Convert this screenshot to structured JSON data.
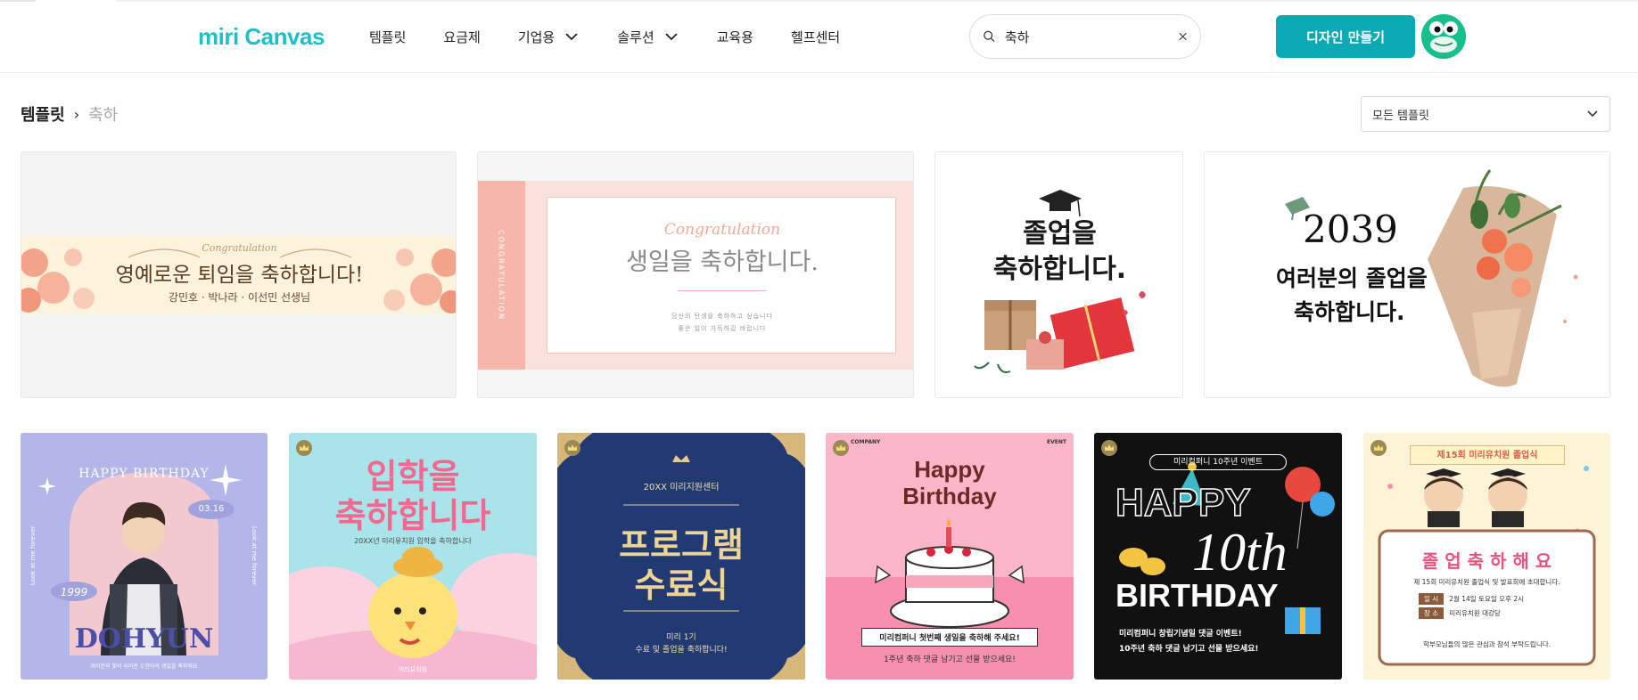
{
  "header": {
    "logo": "miri Canvas",
    "nav": [
      {
        "label": "템플릿",
        "dropdown": false
      },
      {
        "label": "요금제",
        "dropdown": false
      },
      {
        "label": "기업용",
        "dropdown": true
      },
      {
        "label": "솔루션",
        "dropdown": true
      },
      {
        "label": "교육용",
        "dropdown": false
      },
      {
        "label": "헬프센터",
        "dropdown": false
      }
    ],
    "search_value": "축하",
    "design_button": "디자인 만들기"
  },
  "breadcrumb": {
    "root": "템플릿",
    "current": "축하"
  },
  "filter": {
    "selected": "모든 템플릿"
  },
  "cards": {
    "c1": {
      "script": "Congratulation",
      "title": "영예로운 퇴임을 축하합니다!",
      "subtitle": "강민호 · 박나라 · 이선민 선생님"
    },
    "c2": {
      "side": "CONGRATULATION",
      "script": "Congratulation",
      "title": "생일을 축하합니다.",
      "line1": "당신의 탄생을 축하하고 싶습니다",
      "line2": "좋은 일이 가득하길 바랍니다"
    },
    "c3": {
      "line1": "졸업을",
      "line2": "축하합니다."
    },
    "c4": {
      "year": "2039",
      "line1": "여러분의 졸업을",
      "line2": "축하합니다."
    },
    "c5": {
      "top": "HAPPY BIRTHDAY",
      "date": "03.16",
      "year": "1999",
      "name": "DOHYUN",
      "side_left": "Look at me forever",
      "side_right": "Look at me forever",
      "footer": "여러분의 빛이 되어준 도현이의 생일을 축하해요"
    },
    "c6": {
      "title1": "입학을",
      "title2": "축하합니다",
      "sub": "20XX년 미리유치원 입학을 축하합니다",
      "footer": "미리유치원"
    },
    "c7": {
      "org": "20XX 미리지원센터",
      "title1": "프로그램",
      "title2": "수료식",
      "sub1": "미리 1기",
      "sub2": "수료 및 졸업을 축하합니다!"
    },
    "c8": {
      "company": "COMPANY",
      "event": "EVENT",
      "title1": "Happy",
      "title2": "Birthday",
      "sub": "미리컴퍼니 첫번째 생일을 축하해 주세요!",
      "footer": "1주년 축하 댓글 남기고 선물 받으세요!"
    },
    "c9": {
      "badge": "미리컴퍼니 10주년 이벤트",
      "happy": "HAPPY",
      "tenth": "10th",
      "birthday": "BIRTHDAY",
      "line1": "미리컴퍼니 창립기념일 댓글 이벤트!",
      "line2": "10주년 축하 댓글 남기고 선물 받으세요!"
    },
    "c10": {
      "banner": "제15회 미리유치원 졸업식",
      "title": "졸 업 축 하 해 요",
      "invite": "제 15회 미리유치원 졸업식 및 발표회에 초대합니다.",
      "date_label": "일 시",
      "date_value": "2월 14일 토요일 오후 2시",
      "place_label": "장 소",
      "place_value": "미리유치원 대강당",
      "footer": "학부모님들의 많은 관심과 참석 부탁드립니다."
    }
  },
  "colors": {
    "brand": "#1fbfc6",
    "button": "#0aa9b4"
  }
}
